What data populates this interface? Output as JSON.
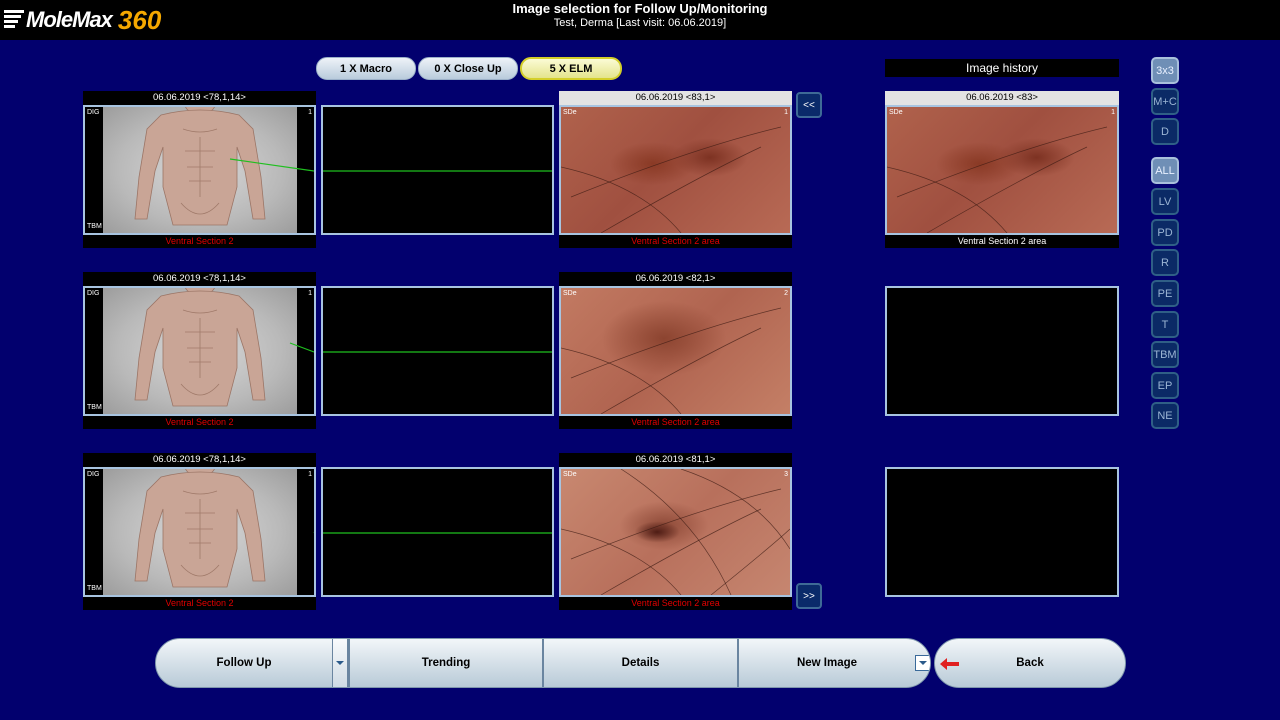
{
  "app": {
    "logo_text": "MoleMax",
    "logo_number": "360",
    "title": "Image selection for Follow Up/Monitoring",
    "subtitle": "Test, Derma [Last visit: 06.06.2019]"
  },
  "tabs": [
    {
      "label": "1 X Macro",
      "active": false
    },
    {
      "label": "0 X Close Up",
      "active": false
    },
    {
      "label": "5 X ELM",
      "active": true
    }
  ],
  "history_title": "Image history",
  "rows": [
    {
      "macro": {
        "date": "06.06.2019 <78,1,14>",
        "caption": "Ventral Section 2",
        "corner_tl": "DIG",
        "corner_tr": "1",
        "corner_bl": "TBM"
      },
      "elm": {
        "date": "06.06.2019 <83,1>",
        "caption": "Ventral Section 2 area",
        "corner_tl": "SDe",
        "corner_tr": "1"
      },
      "history": {
        "date": "06.06.2019 <83>",
        "caption": "Ventral Section 2 area",
        "corner_tl": "SDe",
        "corner_tr": "1"
      }
    },
    {
      "macro": {
        "date": "06.06.2019 <78,1,14>",
        "caption": "Ventral Section 2",
        "corner_tl": "DIG",
        "corner_tr": "1",
        "corner_bl": "TBM"
      },
      "elm": {
        "date": "06.06.2019 <82,1>",
        "caption": "Ventral Section 2 area",
        "corner_tl": "SDe",
        "corner_tr": "2"
      }
    },
    {
      "macro": {
        "date": "06.06.2019 <78,1,14>",
        "caption": "Ventral Section 2",
        "corner_tl": "DIG",
        "corner_tr": "1",
        "corner_bl": "TBM"
      },
      "elm": {
        "date": "06.06.2019 <81,1>",
        "caption": "Ventral Section 2 area",
        "corner_tl": "SDe",
        "corner_tr": "3"
      }
    }
  ],
  "nav": {
    "prev": "<<",
    "next": ">>"
  },
  "side_buttons": [
    {
      "label": "3x3",
      "active": true
    },
    {
      "label": "M+C",
      "active": false
    },
    {
      "label": "D",
      "active": false
    },
    {
      "label": "ALL",
      "active": true
    },
    {
      "label": "LV",
      "active": false
    },
    {
      "label": "PD",
      "active": false
    },
    {
      "label": "R",
      "active": false
    },
    {
      "label": "PE",
      "active": false
    },
    {
      "label": "T",
      "active": false
    },
    {
      "label": "TBM",
      "active": false
    },
    {
      "label": "EP",
      "active": false
    },
    {
      "label": "NE",
      "active": false
    }
  ],
  "bottom": {
    "follow_up": "Follow Up",
    "trending": "Trending",
    "details": "Details",
    "new_image": "New Image",
    "back": "Back"
  },
  "colors": {
    "background": "#02006e",
    "caption_red": "#e00000",
    "tab_active": "#e4e48c",
    "line_green": "#1fbf1f"
  }
}
